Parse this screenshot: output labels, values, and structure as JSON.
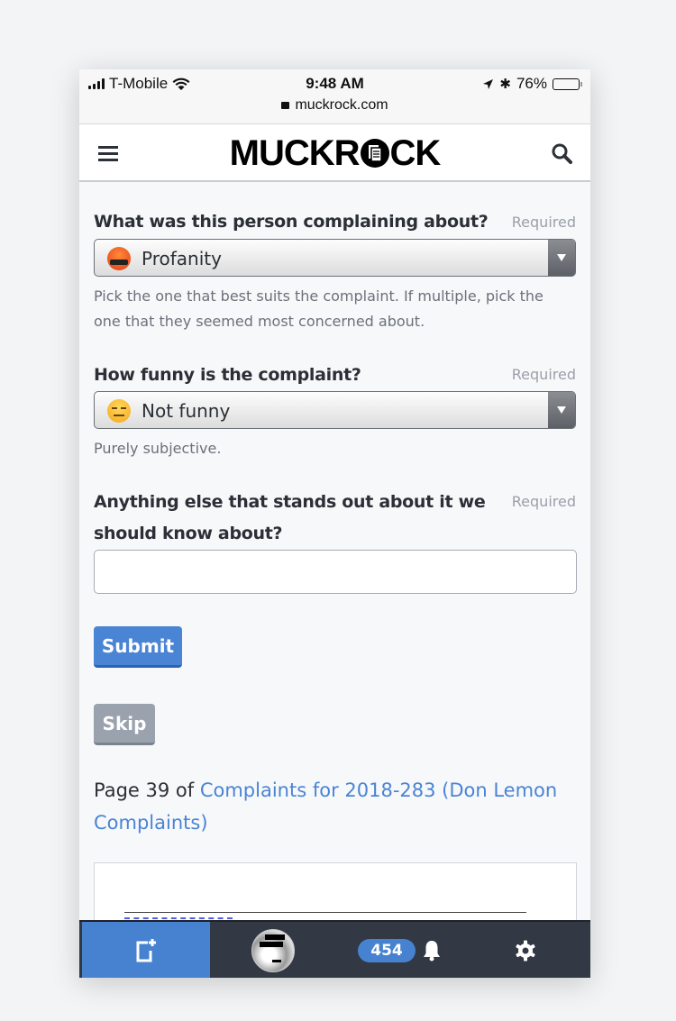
{
  "status_bar": {
    "carrier": "T-Mobile",
    "time": "9:48 AM",
    "battery": "76%",
    "battery_level": 0.76,
    "url": "muckrock.com"
  },
  "header": {
    "logo": "MUCKROCK",
    "menu_icon": "hamburger-icon",
    "search_icon": "search-icon"
  },
  "form": {
    "q1": {
      "label": "What was this person complaining about?",
      "required": "Required",
      "value": "Profanity",
      "emoji": "face-with-symbols-on-mouth",
      "help": "Pick the one that best suits the complaint. If multiple, pick the one that they seemed most concerned about."
    },
    "q2": {
      "label": "How funny is the complaint?",
      "required": "Required",
      "value": "Not funny",
      "emoji": "expressionless-face",
      "help": "Purely subjective."
    },
    "q3": {
      "label": "Anything else that stands out about it we should know about?",
      "required": "Required",
      "value": ""
    },
    "submit_label": "Submit",
    "skip_label": "Skip"
  },
  "page_info": {
    "prefix": "Page 39 of ",
    "link": "Complaints for 2018-283 (Don Lemon Complaints)"
  },
  "bottom_nav": {
    "notification_count": "454",
    "accent": "#4682cf",
    "background": "#323844"
  }
}
